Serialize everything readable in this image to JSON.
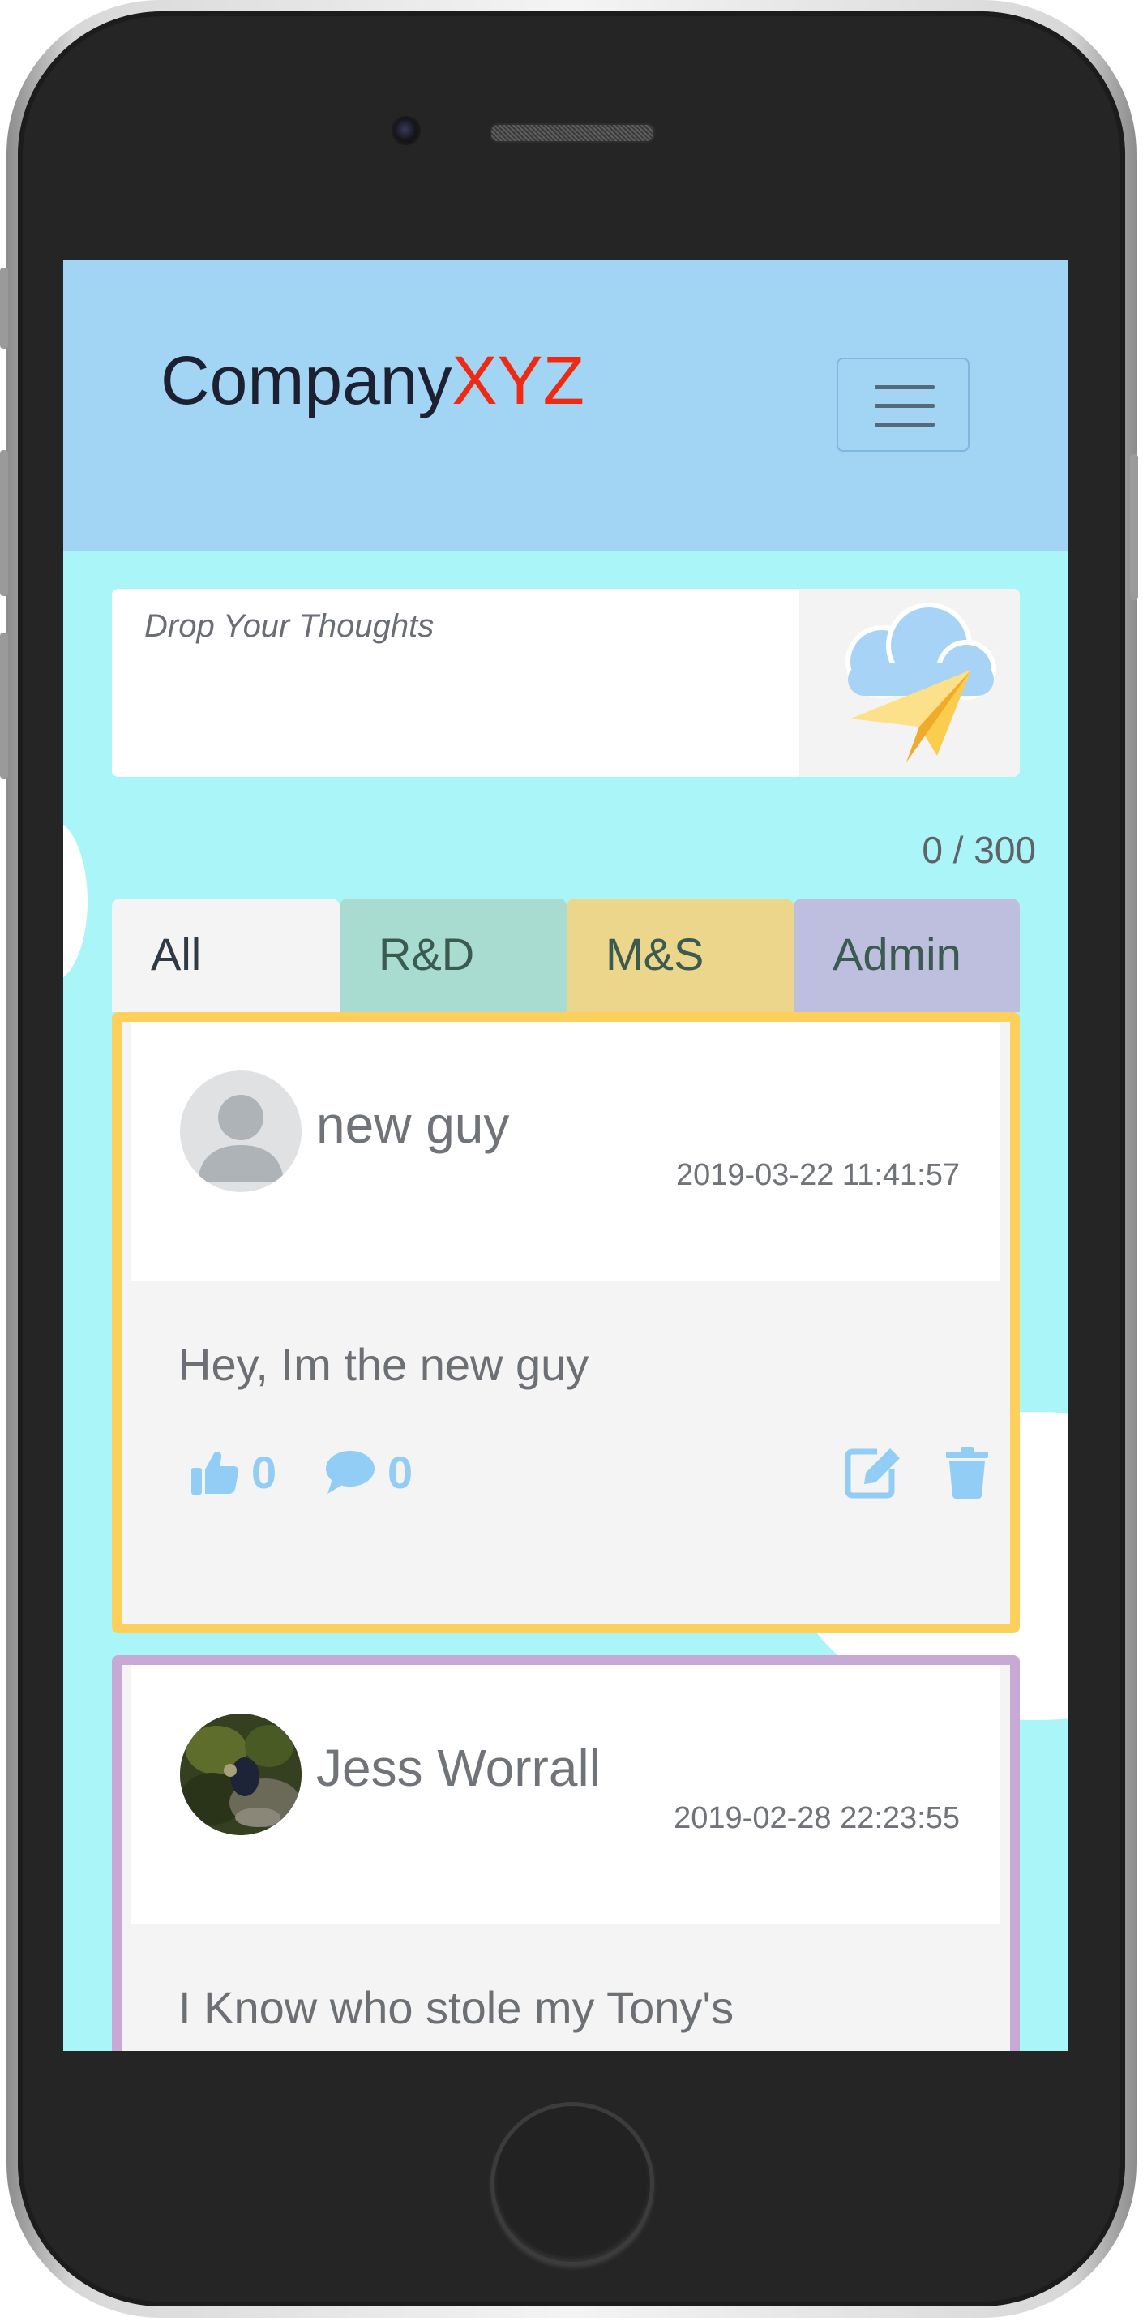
{
  "navbar": {
    "brand_main": "Company",
    "brand_accent": "XYZ",
    "brand_accent_color": "#f02a12",
    "menu_icon": "hamburger-icon"
  },
  "composer": {
    "placeholder": "Drop Your Thoughts",
    "send_icon": "cloud-paper-plane-icon",
    "char_count": "0 / 300"
  },
  "tabs": [
    {
      "label": "All",
      "color": "#f4f4f4",
      "text_color": "#2f3a44"
    },
    {
      "label": "R&D",
      "color": "#a8dcd0",
      "text_color": "#3b5a50"
    },
    {
      "label": "M&S",
      "color": "#ecd68c",
      "text_color": "#3b5a50"
    },
    {
      "label": "Admin",
      "color": "#bebfdf",
      "text_color": "#3b5a50"
    }
  ],
  "posts": [
    {
      "author": "new guy",
      "timestamp": "2019-03-22 11:41:57",
      "content": "Hey, Im the new guy",
      "likes": "0",
      "comments": "0",
      "border_color": "#fdd05c",
      "avatar": "default-user-avatar"
    },
    {
      "author": "Jess Worrall",
      "timestamp": "2019-02-28 22:23:55",
      "content": "I Know who stole my Tony's",
      "border_color": "#c8a8d4",
      "avatar": "photo-avatar"
    }
  ]
}
